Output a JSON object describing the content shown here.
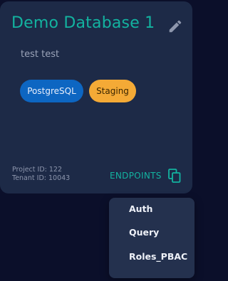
{
  "card": {
    "title": "Demo Database 1",
    "description": "test test",
    "tags": [
      {
        "label": "PostgreSQL",
        "color": "#0d66c2"
      },
      {
        "label": "Staging",
        "color": "#f4aa36"
      }
    ],
    "project_id": "Project ID: 122",
    "tenant_id": "Tenant ID: 10043",
    "endpoints_label": "ENDPOINTS",
    "accent_color": "#13b3a0",
    "edit_icon": "pencil-icon",
    "copy_icon": "copy-icon"
  },
  "endpoints_menu": {
    "items": [
      {
        "label": "Auth"
      },
      {
        "label": "Query"
      },
      {
        "label": "Roles_PBAC"
      }
    ]
  }
}
